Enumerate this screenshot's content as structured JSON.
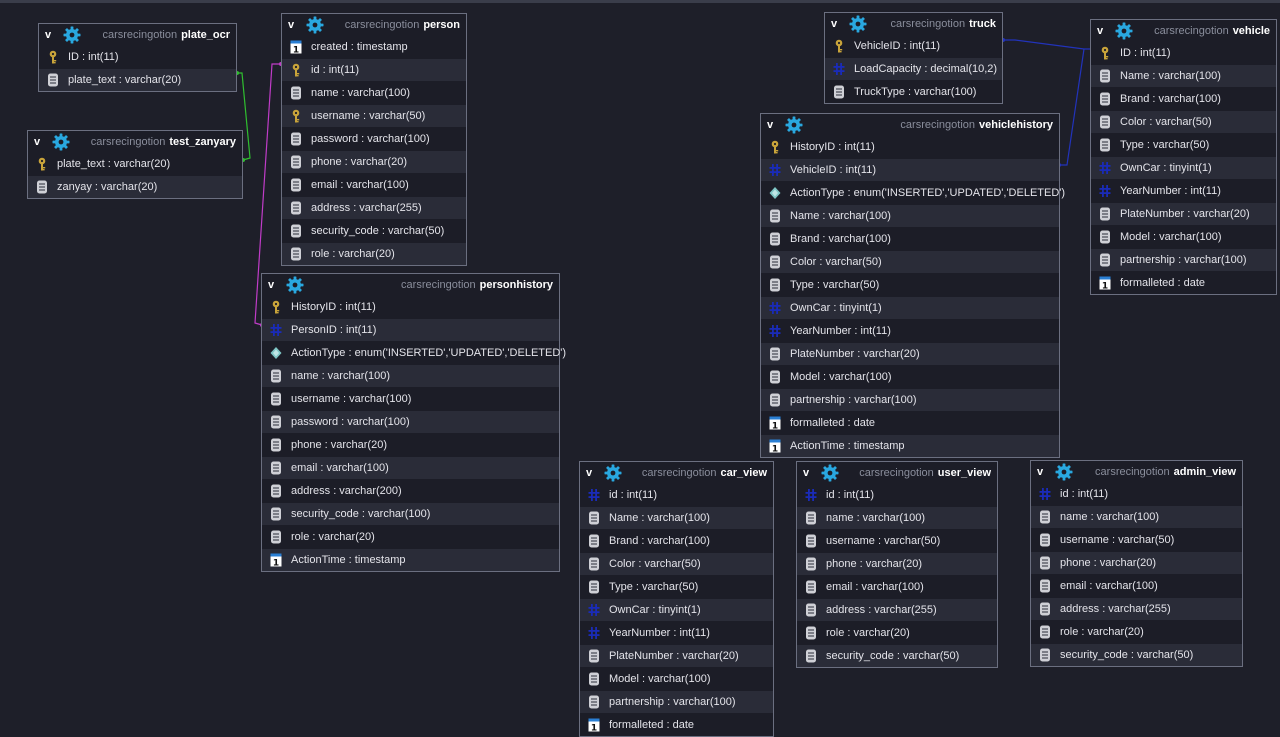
{
  "colors": {
    "background": "#1e1f29",
    "link_green": "#2fbf2f",
    "link_magenta": "#c03cc8",
    "link_blue": "#2233bb",
    "gear": "#29a8e0",
    "key": "#c9a43a",
    "hash": "#1a2bb8"
  },
  "tables": [
    {
      "id": "plate_ocr",
      "db": "carsrecingotion",
      "name": "plate_ocr",
      "collapse": "v",
      "columns": [
        {
          "icon": "key",
          "text": "ID : int(11)"
        },
        {
          "icon": "text",
          "text": "plate_text : varchar(20)"
        }
      ]
    },
    {
      "id": "test_zanyary",
      "db": "carsrecingotion",
      "name": "test_zanyary",
      "collapse": "v",
      "columns": [
        {
          "icon": "key",
          "text": "plate_text : varchar(20)"
        },
        {
          "icon": "text",
          "text": "zanyay : varchar(20)"
        }
      ]
    },
    {
      "id": "person",
      "db": "carsrecingotion",
      "name": "person",
      "collapse": "v",
      "columns": [
        {
          "icon": "date",
          "text": "created : timestamp"
        },
        {
          "icon": "key",
          "text": "id : int(11)"
        },
        {
          "icon": "text",
          "text": "name : varchar(100)"
        },
        {
          "icon": "key",
          "text": "username : varchar(50)"
        },
        {
          "icon": "text",
          "text": "password : varchar(100)"
        },
        {
          "icon": "text",
          "text": "phone : varchar(20)"
        },
        {
          "icon": "text",
          "text": "email : varchar(100)"
        },
        {
          "icon": "text",
          "text": "address : varchar(255)"
        },
        {
          "icon": "text",
          "text": "security_code : varchar(50)"
        },
        {
          "icon": "text",
          "text": "role : varchar(20)"
        }
      ]
    },
    {
      "id": "personhistory",
      "db": "carsrecingotion",
      "name": "personhistory",
      "collapse": "v",
      "columns": [
        {
          "icon": "key",
          "text": "HistoryID : int(11)"
        },
        {
          "icon": "hash",
          "text": "PersonID : int(11)"
        },
        {
          "icon": "enum",
          "text": "ActionType : enum('INSERTED','UPDATED','DELETED')"
        },
        {
          "icon": "text",
          "text": "name : varchar(100)"
        },
        {
          "icon": "text",
          "text": "username : varchar(100)"
        },
        {
          "icon": "text",
          "text": "password : varchar(100)"
        },
        {
          "icon": "text",
          "text": "phone : varchar(20)"
        },
        {
          "icon": "text",
          "text": "email : varchar(100)"
        },
        {
          "icon": "text",
          "text": "address : varchar(200)"
        },
        {
          "icon": "text",
          "text": "security_code : varchar(100)"
        },
        {
          "icon": "text",
          "text": "role : varchar(20)"
        },
        {
          "icon": "date",
          "text": "ActionTime : timestamp"
        }
      ]
    },
    {
      "id": "truck",
      "db": "carsrecingotion",
      "name": "truck",
      "collapse": "v",
      "columns": [
        {
          "icon": "key",
          "text": "VehicleID : int(11)"
        },
        {
          "icon": "hash",
          "text": "LoadCapacity : decimal(10,2)"
        },
        {
          "icon": "text",
          "text": "TruckType : varchar(100)"
        }
      ]
    },
    {
      "id": "vehicle",
      "db": "carsrecingotion",
      "name": "vehicle",
      "collapse": "v",
      "columns": [
        {
          "icon": "key",
          "text": "ID : int(11)"
        },
        {
          "icon": "text",
          "text": "Name : varchar(100)"
        },
        {
          "icon": "text",
          "text": "Brand : varchar(100)"
        },
        {
          "icon": "text",
          "text": "Color : varchar(50)"
        },
        {
          "icon": "text",
          "text": "Type : varchar(50)"
        },
        {
          "icon": "hash",
          "text": "OwnCar : tinyint(1)"
        },
        {
          "icon": "hash",
          "text": "YearNumber : int(11)"
        },
        {
          "icon": "text",
          "text": "PlateNumber : varchar(20)"
        },
        {
          "icon": "text",
          "text": "Model : varchar(100)"
        },
        {
          "icon": "text",
          "text": "partnership : varchar(100)"
        },
        {
          "icon": "date",
          "text": "formalleted : date"
        }
      ]
    },
    {
      "id": "vehiclehistory",
      "db": "carsrecingotion",
      "name": "vehiclehistory",
      "collapse": "v",
      "columns": [
        {
          "icon": "key",
          "text": "HistoryID : int(11)"
        },
        {
          "icon": "hash",
          "text": "VehicleID : int(11)"
        },
        {
          "icon": "enum",
          "text": "ActionType : enum('INSERTED','UPDATED','DELETED')"
        },
        {
          "icon": "text",
          "text": "Name : varchar(100)"
        },
        {
          "icon": "text",
          "text": "Brand : varchar(100)"
        },
        {
          "icon": "text",
          "text": "Color : varchar(50)"
        },
        {
          "icon": "text",
          "text": "Type : varchar(50)"
        },
        {
          "icon": "hash",
          "text": "OwnCar : tinyint(1)"
        },
        {
          "icon": "hash",
          "text": "YearNumber : int(11)"
        },
        {
          "icon": "text",
          "text": "PlateNumber : varchar(20)"
        },
        {
          "icon": "text",
          "text": "Model : varchar(100)"
        },
        {
          "icon": "text",
          "text": "partnership : varchar(100)"
        },
        {
          "icon": "date",
          "text": "formalleted : date"
        },
        {
          "icon": "date",
          "text": "ActionTime : timestamp"
        }
      ]
    },
    {
      "id": "car_view",
      "db": "carsrecingotion",
      "name": "car_view",
      "collapse": "v",
      "columns": [
        {
          "icon": "hash",
          "text": "id : int(11)"
        },
        {
          "icon": "text",
          "text": "Name : varchar(100)"
        },
        {
          "icon": "text",
          "text": "Brand : varchar(100)"
        },
        {
          "icon": "text",
          "text": "Color : varchar(50)"
        },
        {
          "icon": "text",
          "text": "Type : varchar(50)"
        },
        {
          "icon": "hash",
          "text": "OwnCar : tinyint(1)"
        },
        {
          "icon": "hash",
          "text": "YearNumber : int(11)"
        },
        {
          "icon": "text",
          "text": "PlateNumber : varchar(20)"
        },
        {
          "icon": "text",
          "text": "Model : varchar(100)"
        },
        {
          "icon": "text",
          "text": "partnership : varchar(100)"
        },
        {
          "icon": "date",
          "text": "formalleted : date"
        }
      ]
    },
    {
      "id": "user_view",
      "db": "carsrecingotion",
      "name": "user_view",
      "collapse": "v",
      "columns": [
        {
          "icon": "hash",
          "text": "id : int(11)"
        },
        {
          "icon": "text",
          "text": "name : varchar(100)"
        },
        {
          "icon": "text",
          "text": "username : varchar(50)"
        },
        {
          "icon": "text",
          "text": "phone : varchar(20)"
        },
        {
          "icon": "text",
          "text": "email : varchar(100)"
        },
        {
          "icon": "text",
          "text": "address : varchar(255)"
        },
        {
          "icon": "text",
          "text": "role : varchar(20)"
        },
        {
          "icon": "text",
          "text": "security_code : varchar(50)"
        }
      ]
    },
    {
      "id": "admin_view",
      "db": "carsrecingotion",
      "name": "admin_view",
      "collapse": "v",
      "columns": [
        {
          "icon": "hash",
          "text": "id : int(11)"
        },
        {
          "icon": "text",
          "text": "name : varchar(100)"
        },
        {
          "icon": "text",
          "text": "username : varchar(50)"
        },
        {
          "icon": "text",
          "text": "phone : varchar(20)"
        },
        {
          "icon": "text",
          "text": "email : varchar(100)"
        },
        {
          "icon": "text",
          "text": "address : varchar(255)"
        },
        {
          "icon": "text",
          "text": "role : varchar(20)"
        },
        {
          "icon": "text",
          "text": "security_code : varchar(50)"
        }
      ]
    }
  ]
}
